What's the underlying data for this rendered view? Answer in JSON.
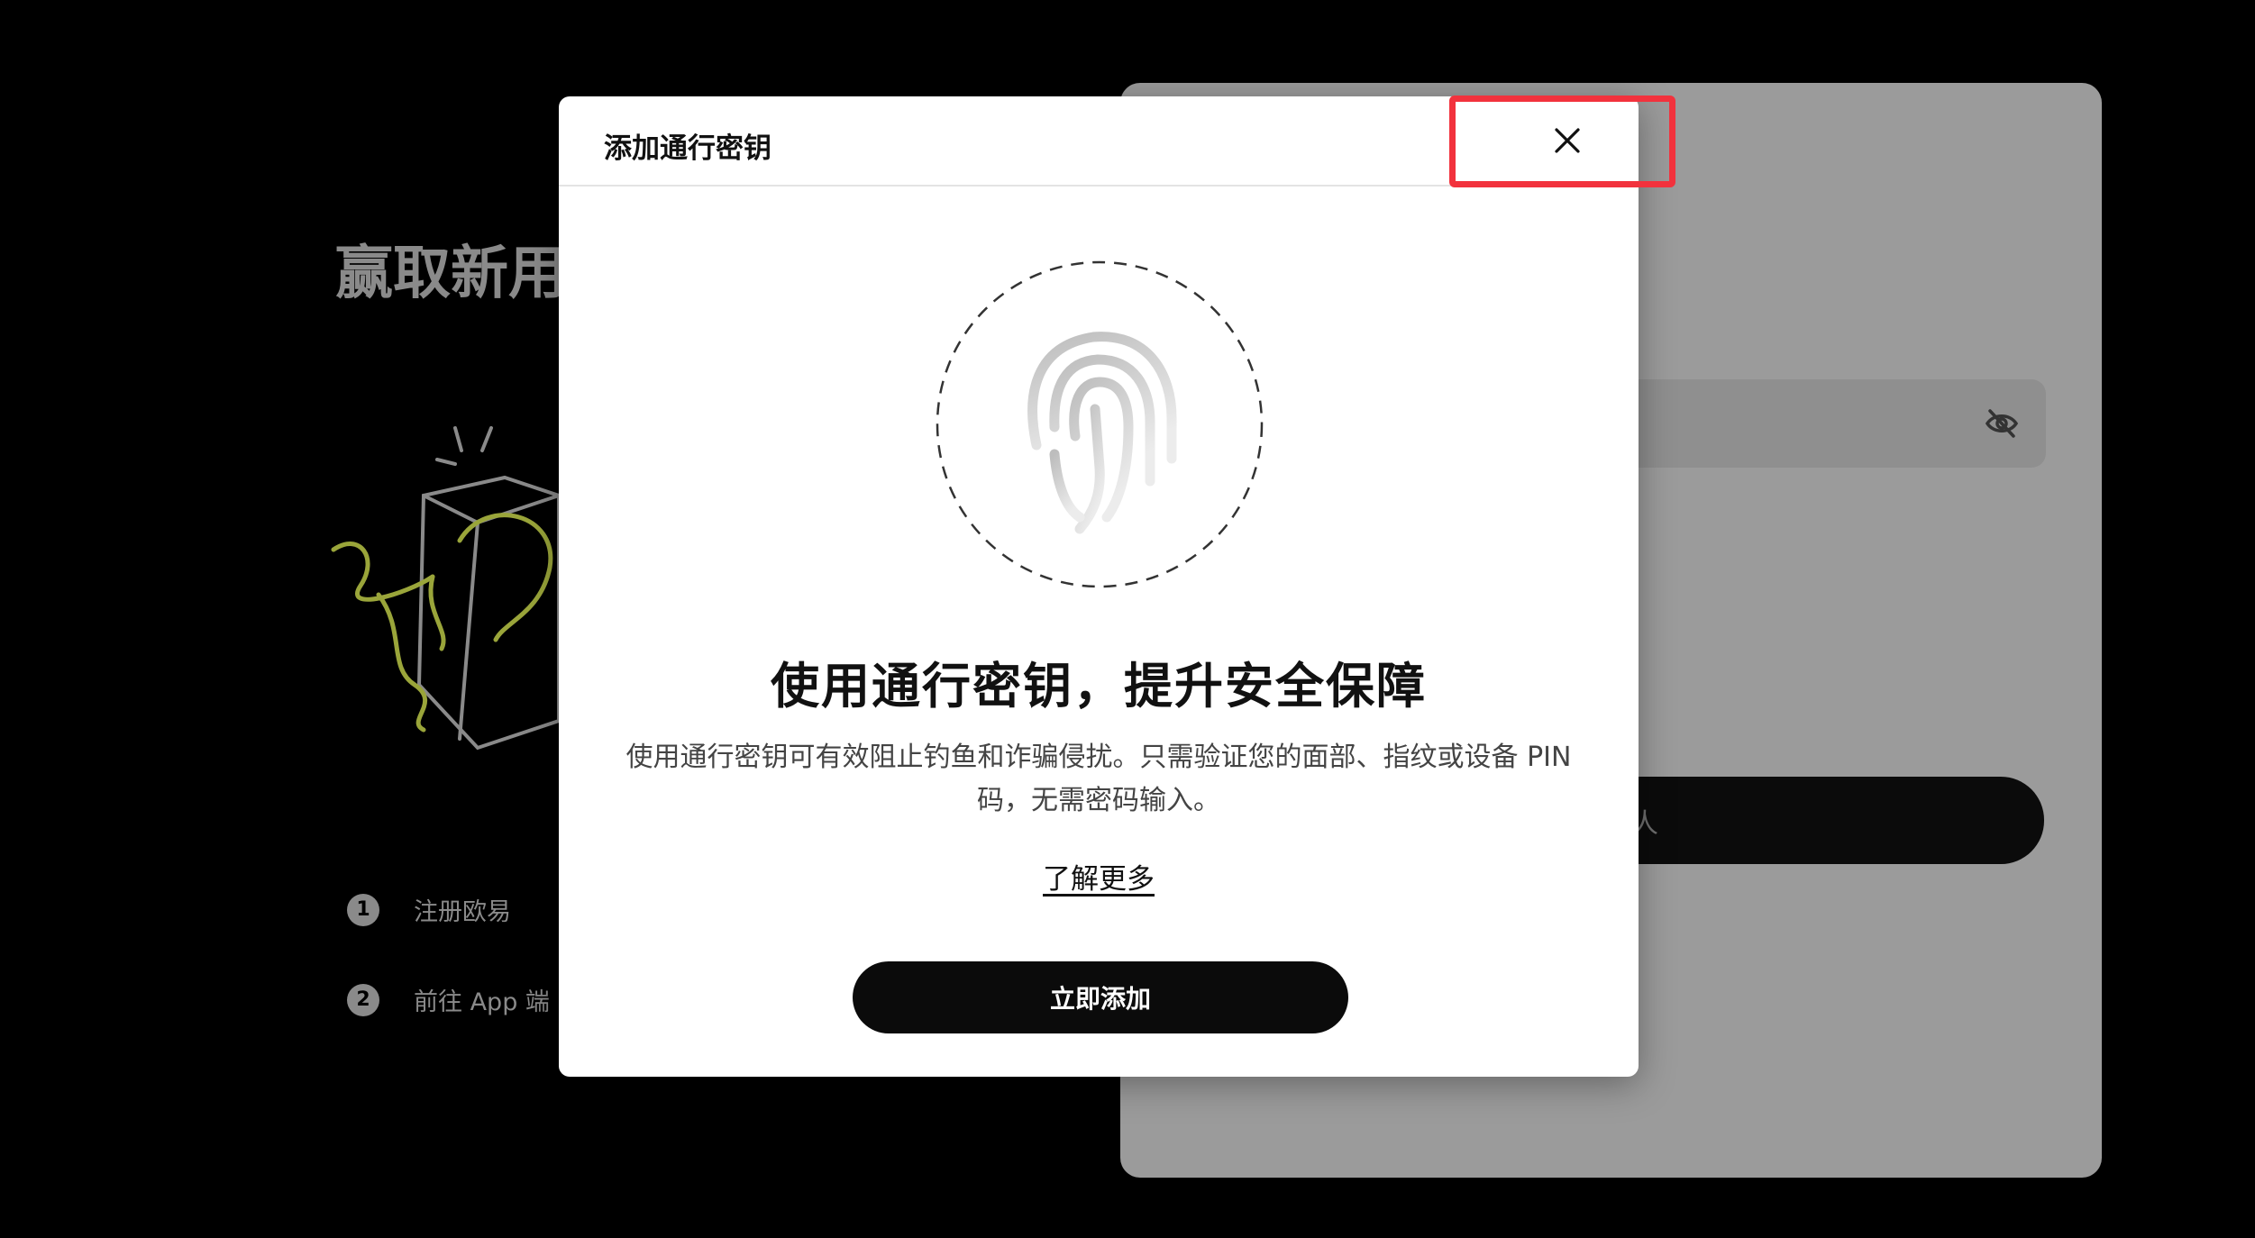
{
  "background": {
    "heading": "赢取新用",
    "steps": [
      {
        "num": "1",
        "label": "注册欧易"
      },
      {
        "num": "2",
        "label": "前往 App 端"
      }
    ],
    "submit_label_partial": "人"
  },
  "modal": {
    "title": "添加通行密钥",
    "heading": "使用通行密钥，提升安全保障",
    "description": "使用通行密钥可有效阻止钓鱼和诈骗侵扰。只需验证您的面部、指纹或设备 PIN 码，无需密码输入。",
    "learn_more": "了解更多",
    "add_button": "立即添加"
  },
  "colors": {
    "highlight": "#f2323d",
    "button_bg": "#0b0b0b",
    "gift_accent": "#9aa53a"
  }
}
